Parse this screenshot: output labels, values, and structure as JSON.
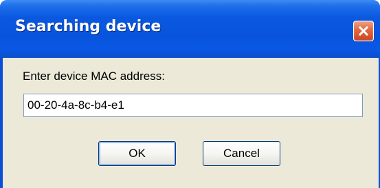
{
  "dialog": {
    "title": "Searching device",
    "prompt_label": "Enter device MAC address:",
    "mac_value": "00-20-4a-8c-b4-e1",
    "ok_label": "OK",
    "cancel_label": "Cancel",
    "close_icon": "close-icon"
  },
  "colors": {
    "titlebar": "#0854dc",
    "client_background": "#ece9d8",
    "close_button": "#e2663f"
  }
}
